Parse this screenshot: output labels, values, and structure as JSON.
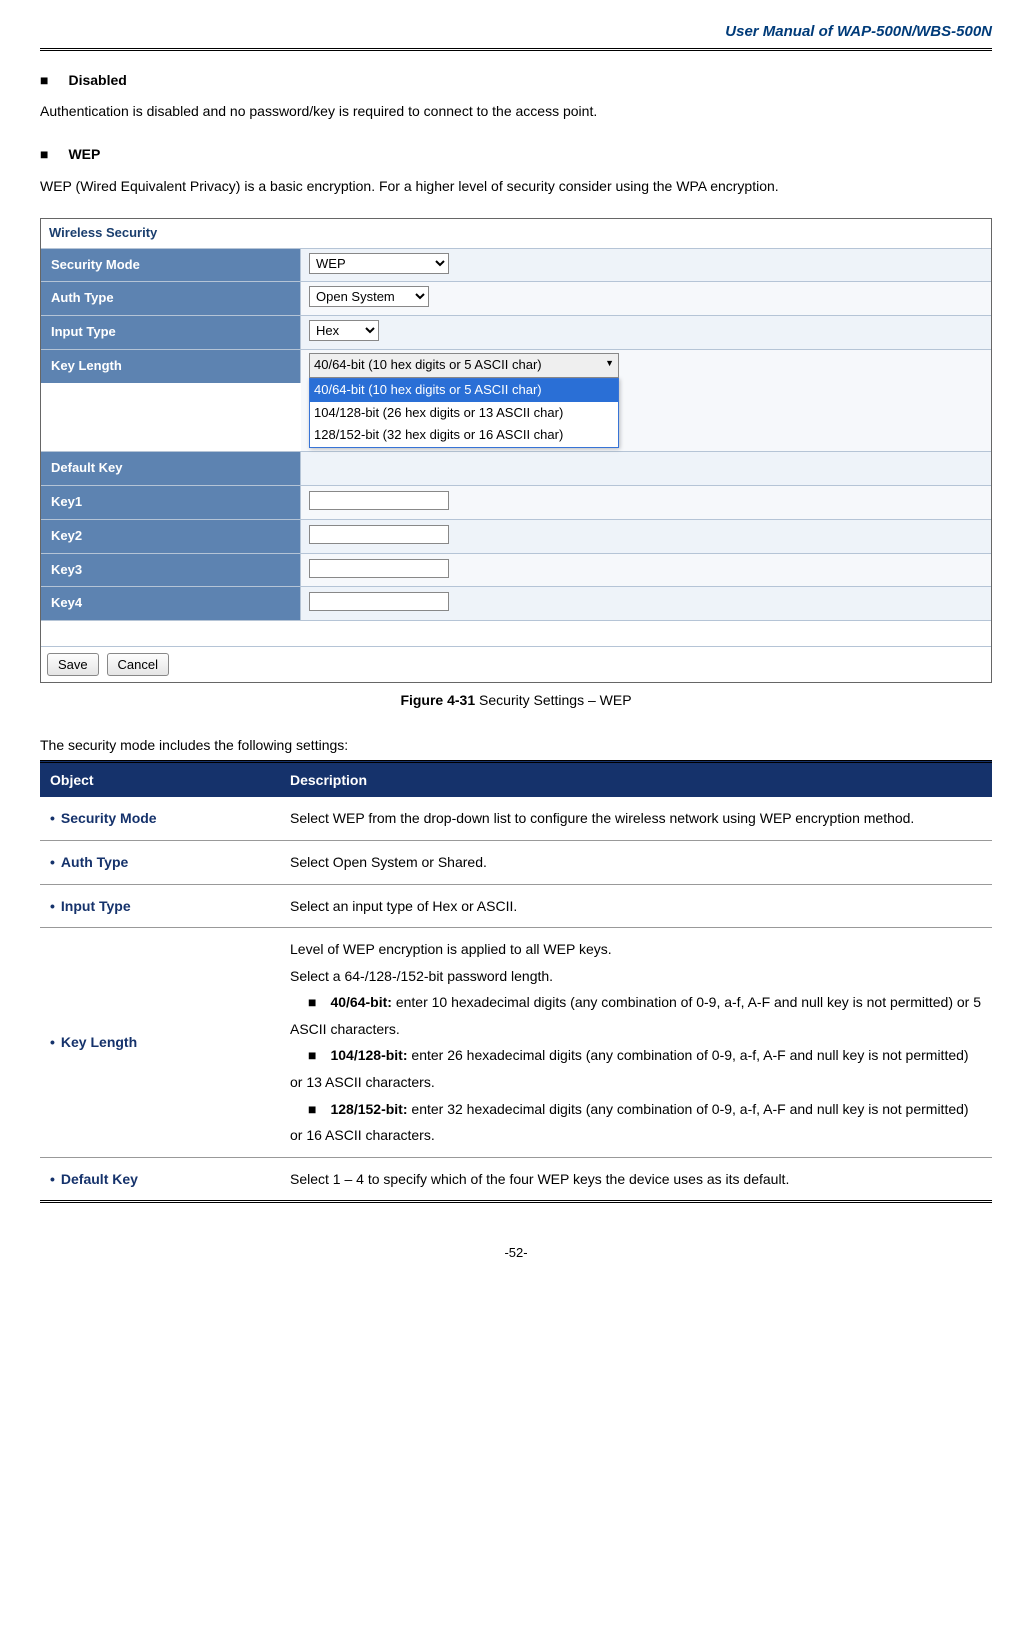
{
  "header": {
    "title": "User Manual of WAP-500N/WBS-500N"
  },
  "section_disabled": {
    "heading": "Disabled",
    "text": "Authentication is disabled and no password/key is required to connect to the access point."
  },
  "section_wep": {
    "heading": "WEP",
    "text": "WEP (Wired Equivalent Privacy) is a basic encryption. For a higher level of security consider using the WPA encryption."
  },
  "screenshot": {
    "title": "Wireless Security",
    "rows": {
      "security_mode": {
        "label": "Security Mode",
        "value": "WEP"
      },
      "auth_type": {
        "label": "Auth Type",
        "value": "Open System"
      },
      "input_type": {
        "label": "Input Type",
        "value": "Hex"
      },
      "key_length": {
        "label": "Key Length",
        "value": "40/64-bit (10 hex digits or 5 ASCII char)",
        "options": [
          "40/64-bit (10 hex digits or 5 ASCII char)",
          "104/128-bit (26 hex digits or 13 ASCII char)",
          "128/152-bit (32 hex digits or 16 ASCII char)"
        ]
      },
      "default_key": {
        "label": "Default Key"
      },
      "key1": {
        "label": "Key1",
        "value": ""
      },
      "key2": {
        "label": "Key2",
        "value": ""
      },
      "key3": {
        "label": "Key3",
        "value": ""
      },
      "key4": {
        "label": "Key4",
        "value": ""
      }
    },
    "buttons": {
      "save": "Save",
      "cancel": "Cancel"
    }
  },
  "figure_caption": {
    "bold": "Figure 4-31",
    "rest": " Security Settings – WEP"
  },
  "table_intro": "The security mode includes the following settings:",
  "desc_table": {
    "head_object": "Object",
    "head_description": "Description",
    "rows": {
      "security_mode": {
        "obj": "Security Mode",
        "desc": "Select WEP from the drop-down list to configure the wireless network using WEP encryption method."
      },
      "auth_type": {
        "obj": "Auth Type",
        "desc": "Select Open System or Shared."
      },
      "input_type": {
        "obj": "Input Type",
        "desc": "Select an input type of Hex or ASCII."
      },
      "key_length": {
        "obj": "Key Length",
        "intro1": "Level of WEP encryption is applied to all WEP keys.",
        "intro2": "Select a 64-/128-/152-bit password length.",
        "b1_bold": "40/64-bit:",
        "b1_rest": " enter 10 hexadecimal digits (any combination of 0-9, a-f, A-F and null key is not permitted) or 5 ASCII characters.",
        "b2_bold": "104/128-bit:",
        "b2_rest": " enter 26 hexadecimal digits (any combination of 0-9, a-f, A-F and null key is not permitted) or 13 ASCII characters.",
        "b3_bold": "128/152-bit:",
        "b3_rest": " enter 32 hexadecimal digits (any combination of 0-9, a-f, A-F and null key is not permitted) or 16 ASCII characters."
      },
      "default_key": {
        "obj": "Default Key",
        "desc": "Select 1 – 4 to specify which of the four WEP keys the device uses as its default."
      }
    }
  },
  "footer": {
    "page": "-52-"
  }
}
